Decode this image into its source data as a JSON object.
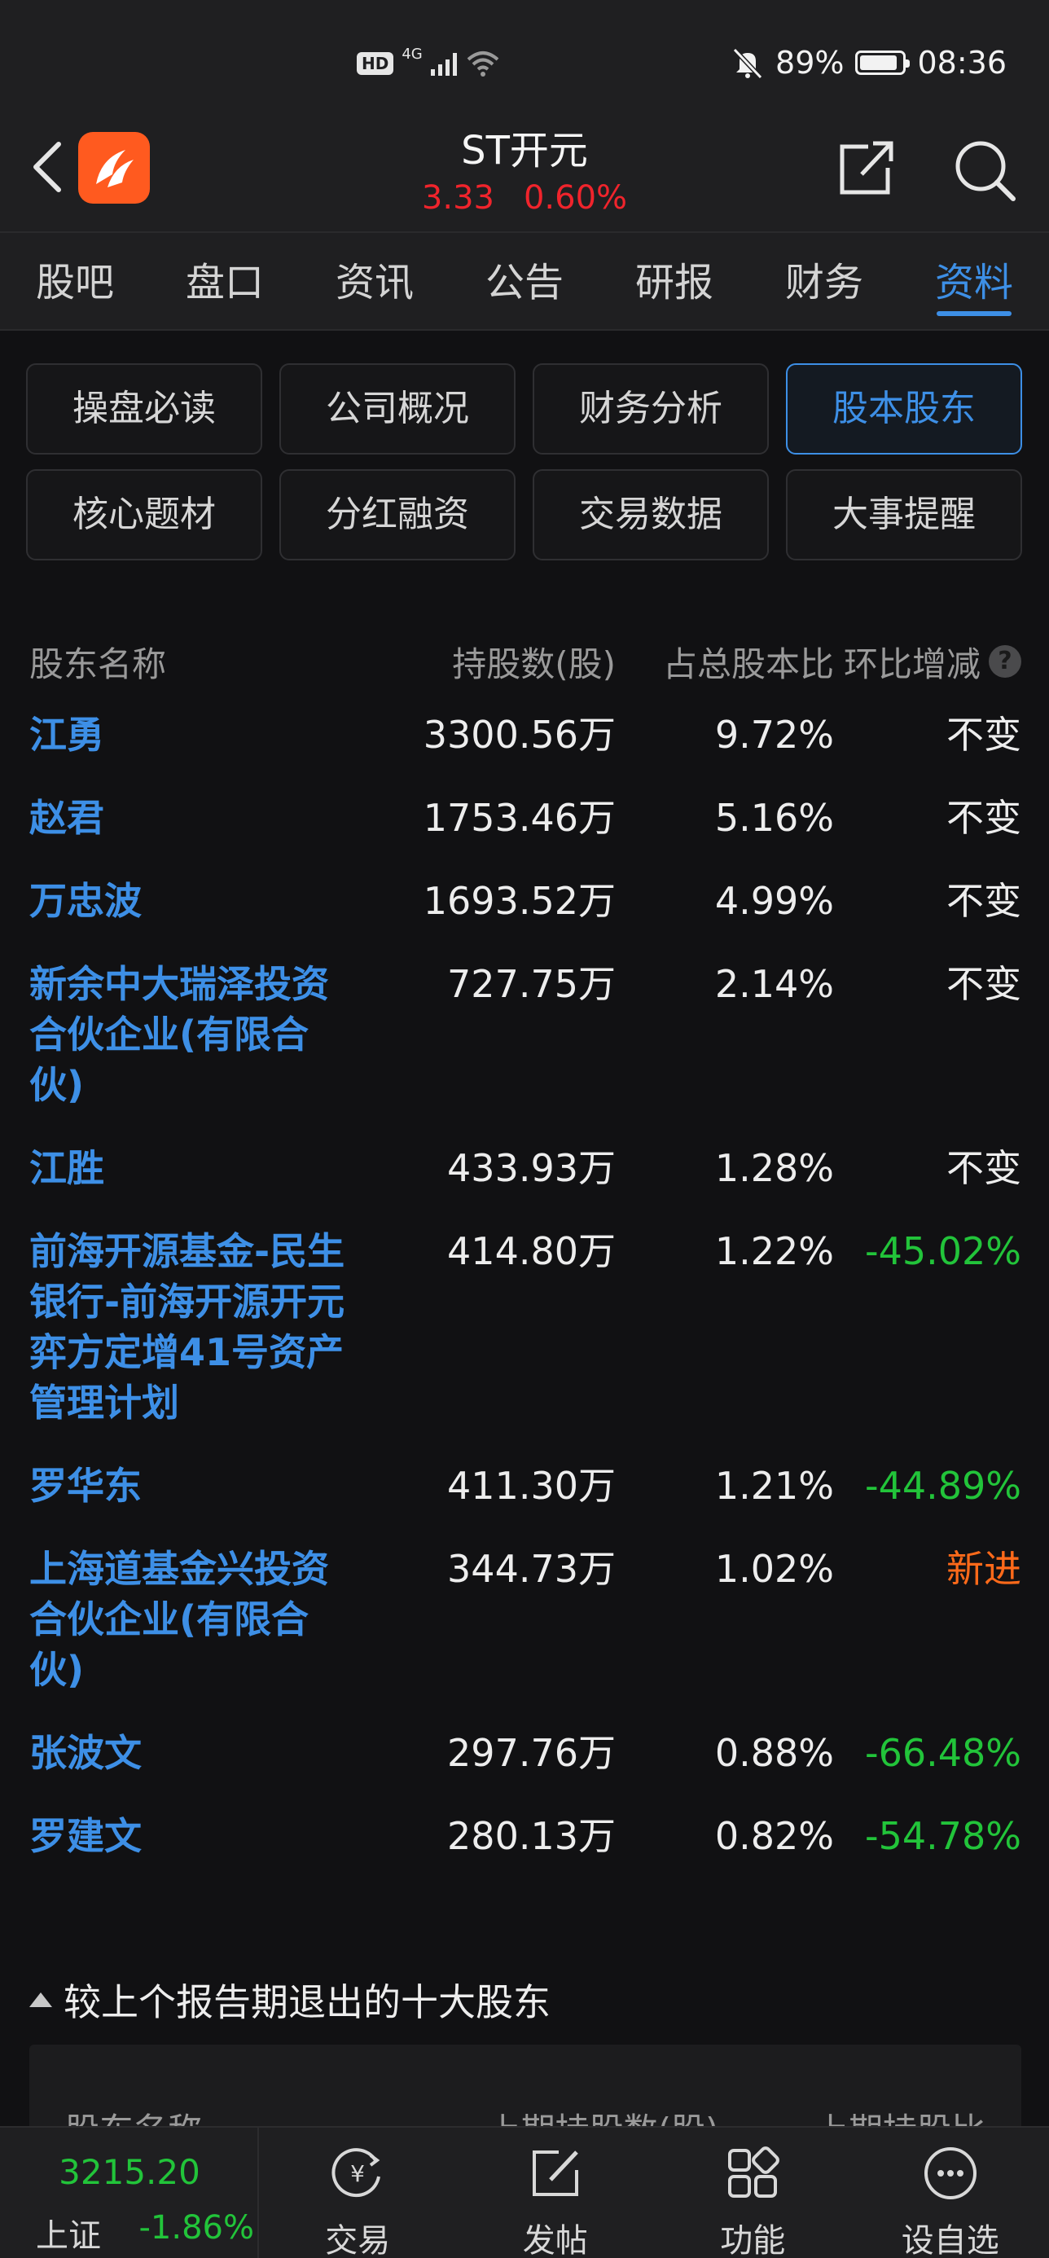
{
  "status_bar": {
    "hd": "HD",
    "network": "4G",
    "battery": "89%",
    "time": "08:36"
  },
  "header": {
    "title": "ST开元",
    "price": "3.33",
    "change_pct": "0.60%",
    "price_color": "#f0242c"
  },
  "main_tabs": [
    "股吧",
    "盘口",
    "资讯",
    "公告",
    "研报",
    "财务",
    "资料"
  ],
  "main_tab_active": "资料",
  "sub_tabs": [
    "操盘必读",
    "公司概况",
    "财务分析",
    "股本股东",
    "核心题材",
    "分红融资",
    "交易数据",
    "大事提醒"
  ],
  "sub_tab_active": "股本股东",
  "holders": {
    "headers": [
      "股东名称",
      "持股数(股)",
      "占总股本比",
      "环比增减"
    ],
    "help": "?",
    "rows": [
      {
        "name": "江勇",
        "shares": "3300.56万",
        "ratio": "9.72%",
        "change": "不变",
        "type": "same"
      },
      {
        "name": "赵君",
        "shares": "1753.46万",
        "ratio": "5.16%",
        "change": "不变",
        "type": "same"
      },
      {
        "name": "万忠波",
        "shares": "1693.52万",
        "ratio": "4.99%",
        "change": "不变",
        "type": "same"
      },
      {
        "name": "新余中大瑞泽投资\n合伙企业(有限合\n伙)",
        "shares": "727.75万",
        "ratio": "2.14%",
        "change": "不变",
        "type": "same"
      },
      {
        "name": "江胜",
        "shares": "433.93万",
        "ratio": "1.28%",
        "change": "不变",
        "type": "same"
      },
      {
        "name": "前海开源基金-民生\n银行-前海开源开元\n弈方定增41号资产\n管理计划",
        "shares": "414.80万",
        "ratio": "1.22%",
        "change": "-45.02%",
        "type": "neg"
      },
      {
        "name": "罗华东",
        "shares": "411.30万",
        "ratio": "1.21%",
        "change": "-44.89%",
        "type": "neg"
      },
      {
        "name": "上海道基金兴投资\n合伙企业(有限合\n伙)",
        "shares": "344.73万",
        "ratio": "1.02%",
        "change": "新进",
        "type": "new"
      },
      {
        "name": "张波文",
        "shares": "297.76万",
        "ratio": "0.88%",
        "change": "-66.48%",
        "type": "neg"
      },
      {
        "name": "罗建文",
        "shares": "280.13万",
        "ratio": "0.82%",
        "change": "-54.78%",
        "type": "neg"
      }
    ]
  },
  "exited": {
    "title": "较上个报告期退出的十大股东",
    "headers": [
      "股东名称",
      "上期持股数(股)",
      "上期持股比"
    ]
  },
  "bottom_bar": {
    "index_value": "3215.20",
    "index_name": "上证",
    "index_change": "-1.86%",
    "nav": [
      {
        "label": "交易",
        "icon": "yuan-circle-icon"
      },
      {
        "label": "发帖",
        "icon": "compose-icon"
      },
      {
        "label": "功能",
        "icon": "grid-icon"
      },
      {
        "label": "设自选",
        "icon": "more-circle-icon"
      }
    ]
  },
  "colors": {
    "accent": "#3d8fe6",
    "up": "#f0242c",
    "down": "#22c43a",
    "new": "#ff6a1a",
    "background": "#111113"
  }
}
